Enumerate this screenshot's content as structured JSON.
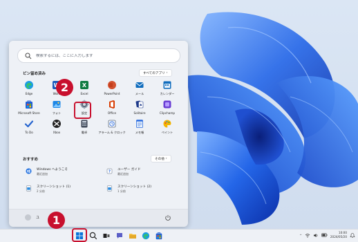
{
  "start_menu": {
    "search": {
      "placeholder": "検索するには、ここに入力します"
    },
    "pinned": {
      "title": "ピン留め済み",
      "all_apps_label": "すべてのアプリ",
      "apps": [
        {
          "label": "Edge",
          "icon": "edge-icon"
        },
        {
          "label": "Word",
          "icon": "word-icon"
        },
        {
          "label": "Excel",
          "icon": "excel-icon"
        },
        {
          "label": "PowerPoint",
          "icon": "powerpoint-icon"
        },
        {
          "label": "メール",
          "icon": "mail-icon"
        },
        {
          "label": "カレンダー",
          "icon": "calendar-icon"
        },
        {
          "label": "Microsoft Store",
          "icon": "store-icon"
        },
        {
          "label": "フォト",
          "icon": "photos-icon"
        },
        {
          "label": "設定",
          "icon": "settings-icon"
        },
        {
          "label": "Office",
          "icon": "office-icon"
        },
        {
          "label": "Solitaire",
          "icon": "solitaire-icon"
        },
        {
          "label": "Clipchamp",
          "icon": "clipchamp-icon"
        },
        {
          "label": "To Do",
          "icon": "todo-icon"
        },
        {
          "label": "Xbox",
          "icon": "xbox-icon"
        },
        {
          "label": "電卓",
          "icon": "calculator-icon"
        },
        {
          "label": "アラーム & クロック",
          "icon": "alarm-clock-icon"
        },
        {
          "label": "メモ帳",
          "icon": "notepad-icon"
        },
        {
          "label": "ペイント",
          "icon": "paint-icon"
        }
      ]
    },
    "recommended": {
      "title": "おすすめ",
      "more_label": "その他",
      "items": [
        {
          "title": "Windows へようこそ",
          "subtitle": "最近追加",
          "icon": "windows-welcome-icon"
        },
        {
          "title": "ユーザー ガイド",
          "subtitle": "最近追加",
          "icon": "user-guide-icon"
        },
        {
          "title": "スクリーンショット (1)",
          "subtitle": "2 分前",
          "icon": "image-file-icon"
        },
        {
          "title": "スクリーンショット (2)",
          "subtitle": "1 分前",
          "icon": "image-file-icon"
        }
      ]
    },
    "user": {
      "name": "ユ"
    }
  },
  "badges": {
    "step1": "1",
    "step2": "2"
  },
  "taskbar": {
    "icons": [
      "start-icon",
      "search-icon",
      "task-view-icon",
      "chat-icon",
      "file-explorer-icon",
      "edge-icon",
      "store-icon"
    ],
    "tray": {
      "chevron": "^",
      "time": "10:00",
      "date": "2024/05/20"
    }
  },
  "colors": {
    "accent": "#0067c0",
    "highlight": "#c8102e",
    "menu_bg": "#eef1f6",
    "wallpaper_blue": "#1f5fe0"
  }
}
